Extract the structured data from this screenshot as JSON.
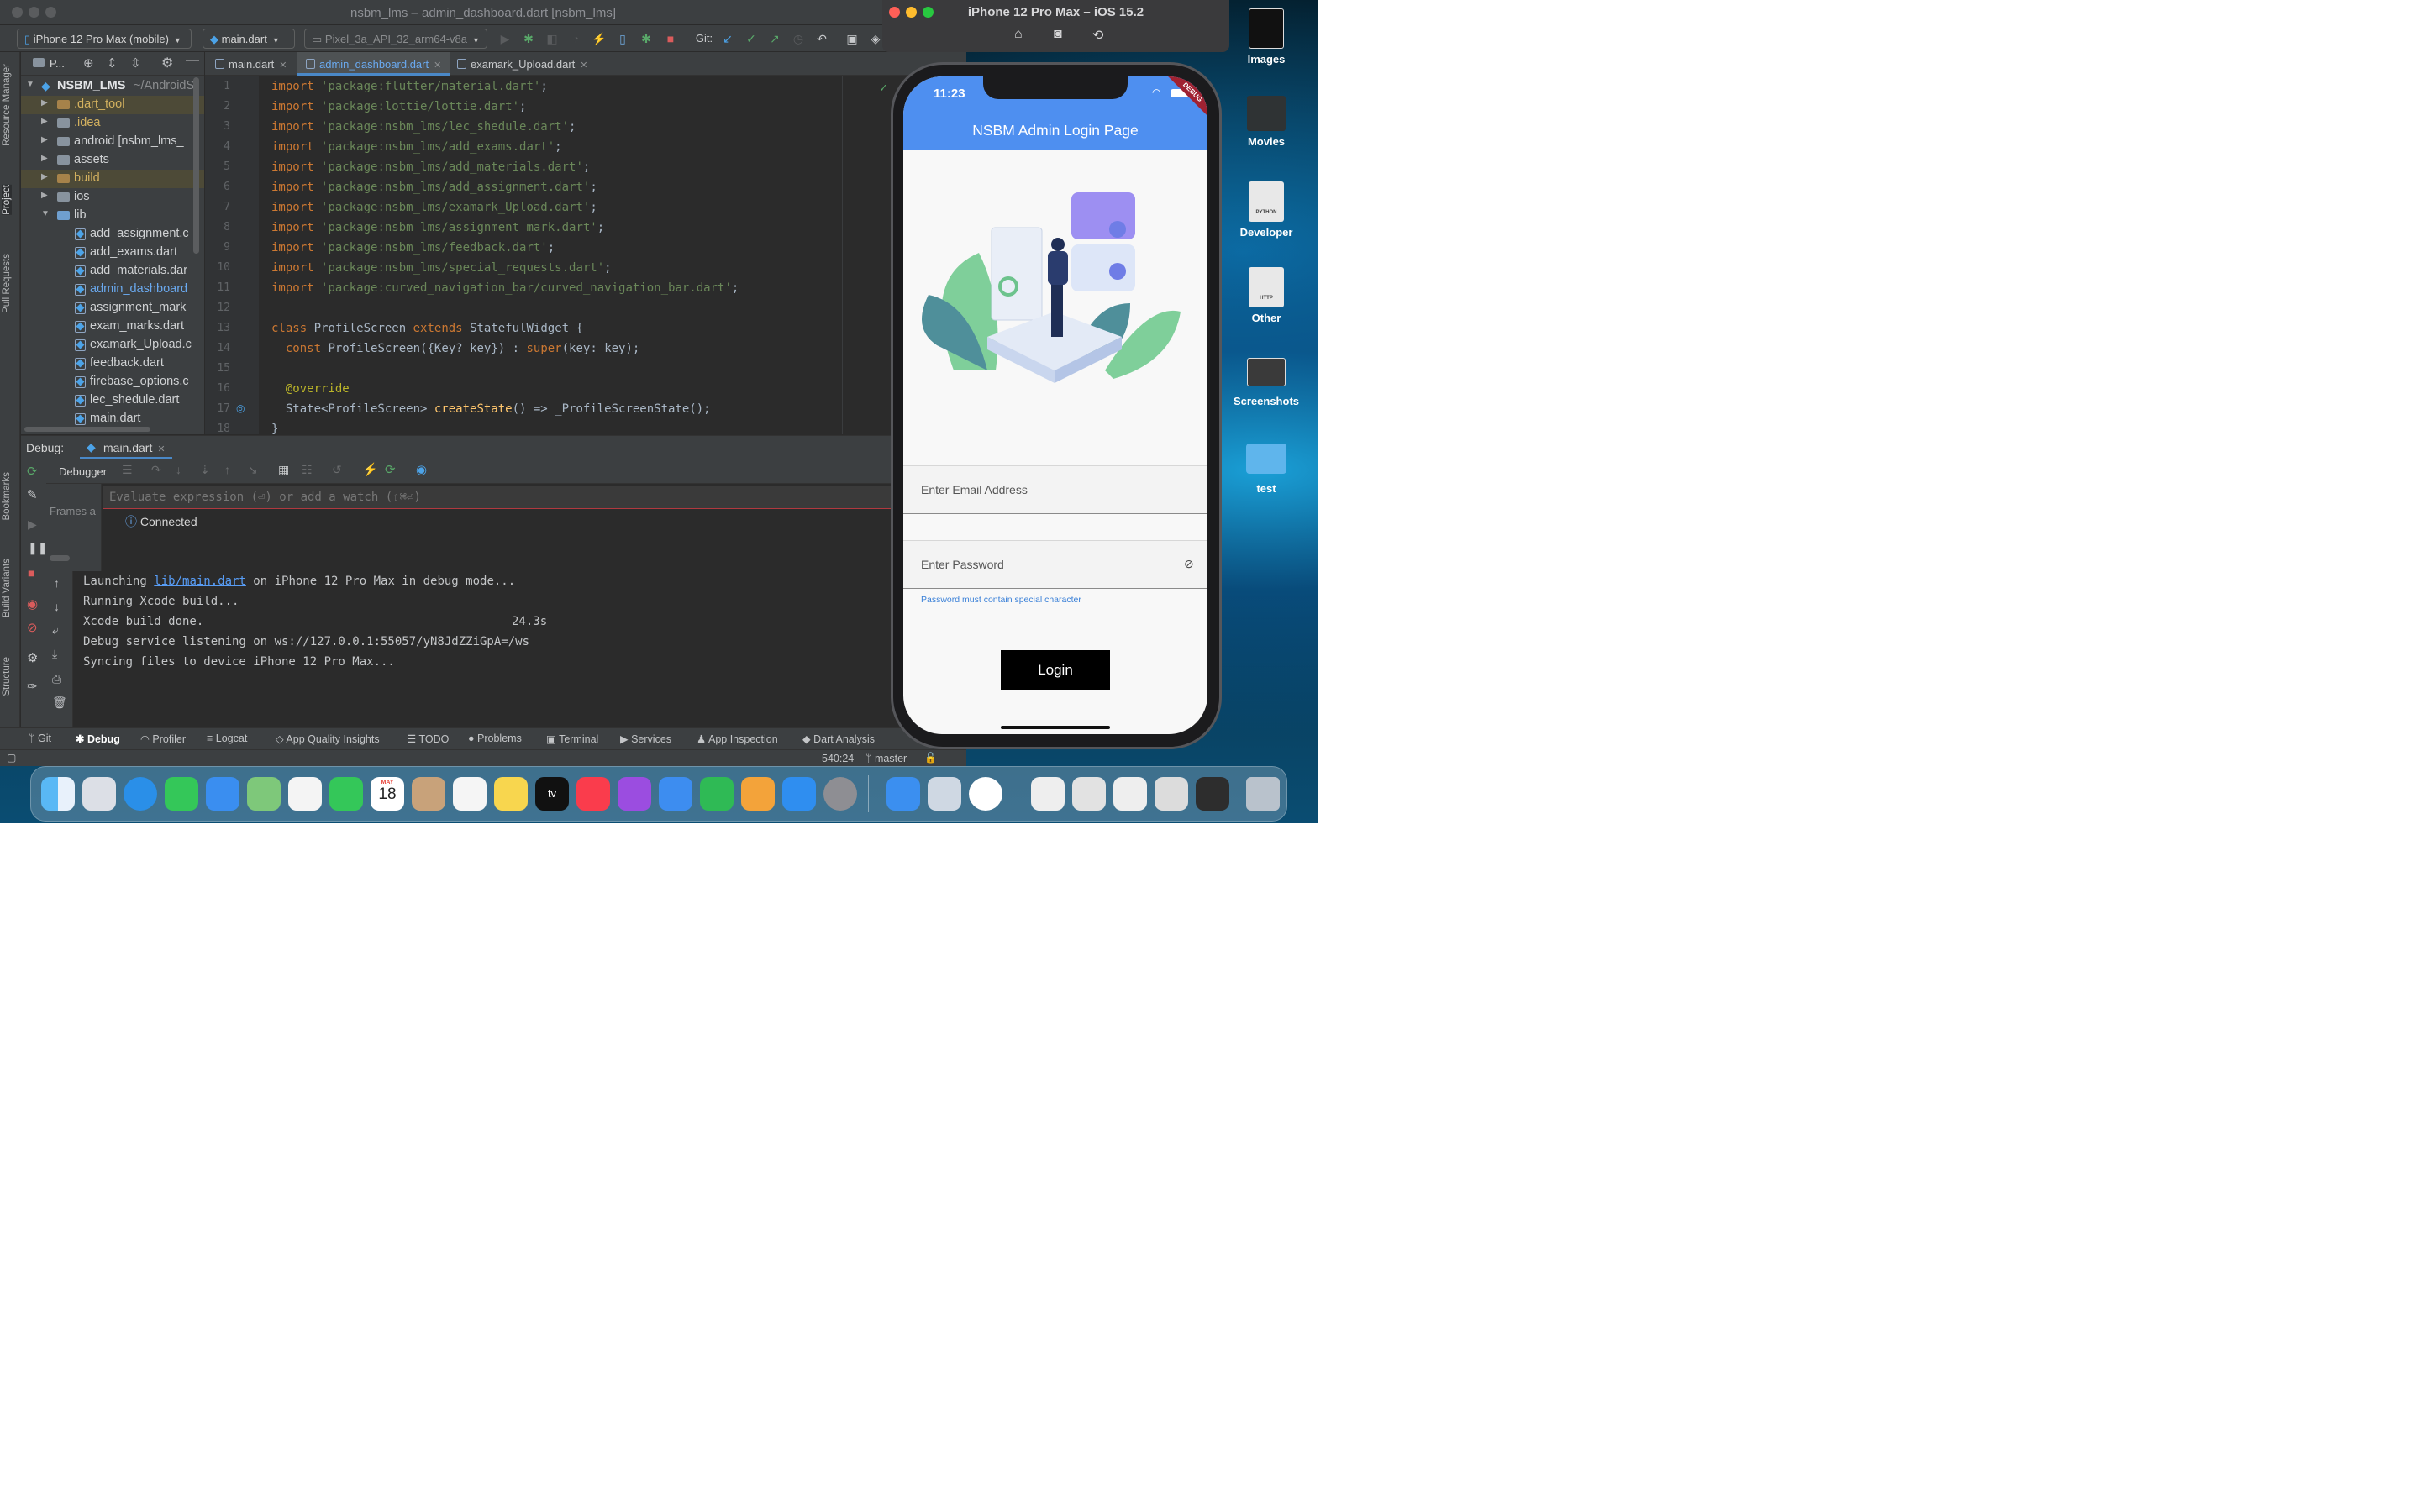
{
  "ide": {
    "title": "nsbm_lms – admin_dashboard.dart [nsbm_lms]",
    "toolbar": {
      "device": "iPhone 12 Pro Max (mobile)",
      "config": "main.dart",
      "emulator": "Pixel_3a_API_32_arm64-v8a",
      "git_label": "Git:"
    },
    "left_strip": [
      "Resource Manager",
      "Project",
      "Pull Requests",
      "Bookmarks",
      "Build Variants",
      "Structure"
    ],
    "project": {
      "header": "P...",
      "root": "NSBM_LMS",
      "root_path": "~/AndroidS",
      "tree": [
        ".dart_tool",
        ".idea",
        "android [nsbm_lms_",
        "assets",
        "build",
        "ios",
        "lib"
      ],
      "files": [
        "add_assignment.c",
        "add_exams.dart",
        "add_materials.dar",
        "admin_dashboard",
        "assignment_mark",
        "exam_marks.dart",
        "examark_Upload.c",
        "feedback.dart",
        "firebase_options.c",
        "lec_shedule.dart",
        "main.dart"
      ]
    },
    "tabs": [
      "main.dart",
      "admin_dashboard.dart",
      "examark_Upload.dart"
    ],
    "code": {
      "line_numbers": [
        "1",
        "2",
        "3",
        "4",
        "5",
        "6",
        "7",
        "8",
        "9",
        "10",
        "11",
        "12",
        "13",
        "14",
        "15",
        "16",
        "17",
        "18"
      ],
      "imports": [
        "'package:flutter/material.dart'",
        "'package:lottie/lottie.dart'",
        "'package:nsbm_lms/lec_shedule.dart'",
        "'package:nsbm_lms/add_exams.dart'",
        "'package:nsbm_lms/add_materials.dart'",
        "'package:nsbm_lms/add_assignment.dart'",
        "'package:nsbm_lms/examark_Upload.dart'",
        "'package:nsbm_lms/assignment_mark.dart'",
        "'package:nsbm_lms/feedback.dart'",
        "'package:nsbm_lms/special_requests.dart'",
        "'package:curved_navigation_bar/curved_navigation_bar.dart'"
      ],
      "kw_import": "import",
      "kw_class": "class",
      "class_name": "ProfileScreen",
      "kw_extends": "extends",
      "superclass": "StatefulWidget {",
      "kw_const": "const",
      "ctor": "ProfileScreen({Key? key}) :",
      "kw_super": "super",
      "ctor_end": "(key: key);",
      "override": "@override",
      "state_type": "State<ProfileScreen>",
      "create_state": "createState",
      "create_state_end": "() => _ProfileScreenState();",
      "brace": "}"
    },
    "debug": {
      "label": "Debug:",
      "tab": "main.dart",
      "debugger": "Debugger",
      "eval_placeholder": "Evaluate expression (⏎) or add a watch (⇧⌘⏎)",
      "frames": "Frames a",
      "connected": "Connected",
      "console": {
        "l1_pre": "Launching ",
        "l1_link": "lib/main.dart",
        "l1_post": " on iPhone 12 Pro Max in debug mode...",
        "l2": "Running Xcode build...",
        "l3": "Xcode build done.",
        "l3_time": "24.3s",
        "l4": "Debug service listening on ws://127.0.0.1:55057/yN8JdZZiGpA=/ws",
        "l5": "Syncing files to device iPhone 12 Pro Max..."
      }
    },
    "bottom_tabs": [
      "Git",
      "Debug",
      "Profiler",
      "Logcat",
      "App Quality Insights",
      "TODO",
      "Problems",
      "Terminal",
      "Services",
      "App Inspection",
      "Dart Analysis"
    ],
    "status": {
      "position": "540:24",
      "branch": "master"
    }
  },
  "simulator": {
    "title": "iPhone 12 Pro Max – iOS 15.2",
    "time": "11:23",
    "debug_banner": "DEBUG",
    "app_title": "NSBM Admin Login Page",
    "email_placeholder": "Enter Email Address",
    "password_placeholder": "Enter Password",
    "helper": "Password must contain special character",
    "login": "Login",
    "accent": "#4e8ff0"
  },
  "desktop": [
    "Images",
    "Movies",
    "Developer",
    "Other",
    "Screenshots",
    "test"
  ],
  "desktop_thumbs": {
    "developer": "PYTHON",
    "other": "HTTP"
  },
  "dock": {
    "calendar_month": "MAY",
    "calendar_day": "18",
    "tv": "tv"
  }
}
